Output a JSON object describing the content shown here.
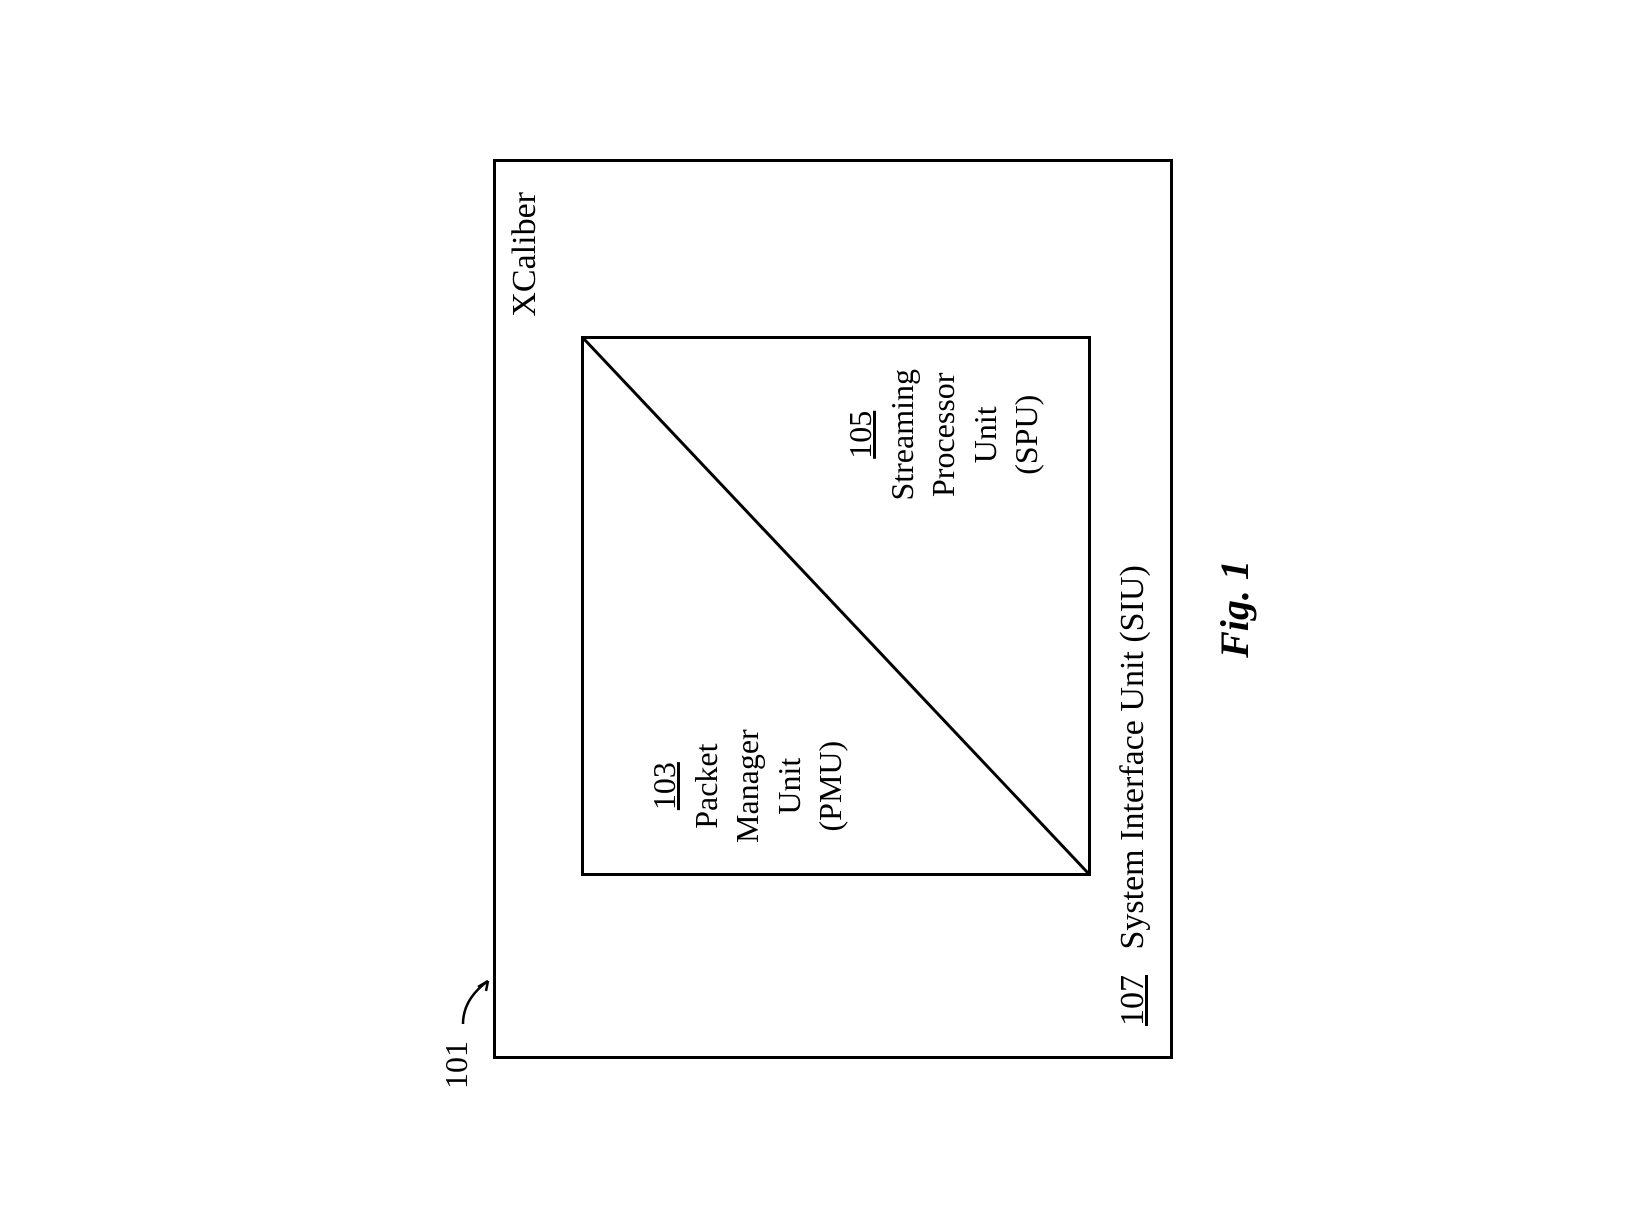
{
  "diagram": {
    "ref_101": "101",
    "title": "XCaliber",
    "siu_ref": "107",
    "siu_label": "System Interface Unit (SIU)",
    "inner": {
      "pmu": {
        "ref": "103",
        "line1": "Packet",
        "line2": "Manager",
        "line3": "Unit",
        "line4": "(PMU)"
      },
      "spu": {
        "ref": "105",
        "line1": "Streaming",
        "line2": "Processor",
        "line3": "Unit",
        "line4": "(SPU)"
      }
    },
    "caption": "Fig. 1"
  }
}
